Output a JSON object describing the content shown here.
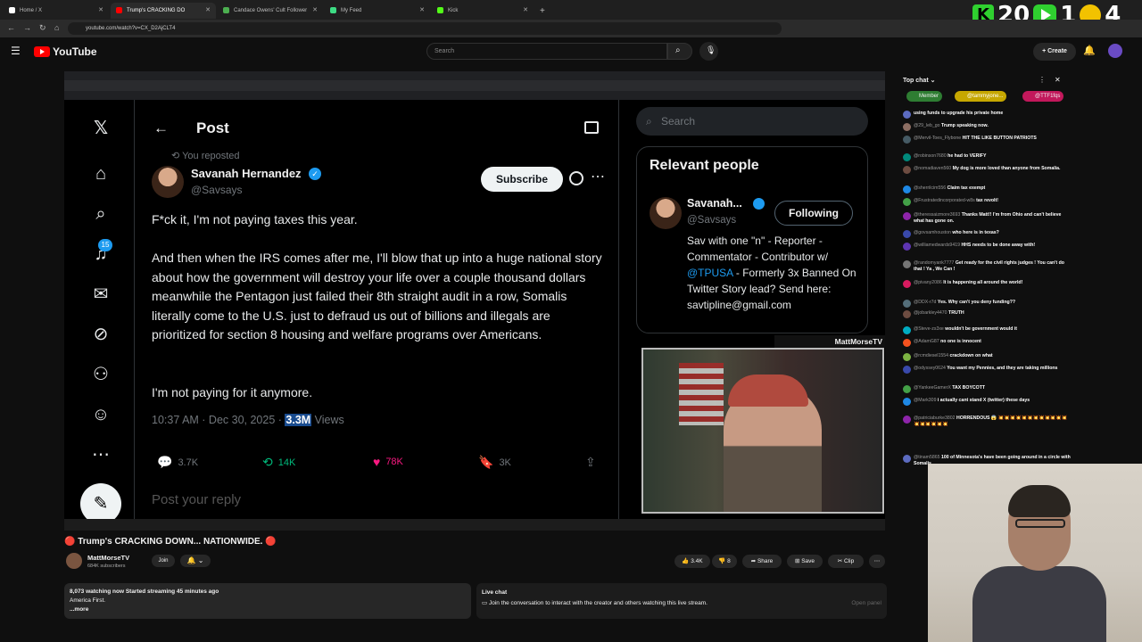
{
  "browser": {
    "tabs": [
      {
        "label": "Home / X",
        "active": false,
        "color": "#ffffff"
      },
      {
        "label": "Trump's CRACKING DO",
        "active": true,
        "color": "#ff0000"
      },
      {
        "label": "Candace Owens' Cult Follower",
        "active": false,
        "color": "#4caf50"
      },
      {
        "label": "My Feed",
        "active": false,
        "color": "#3ddc84"
      },
      {
        "label": "Kick",
        "active": false,
        "color": "#53fc18"
      }
    ],
    "url": "youtube.com/watch?v=CX_D2AjCLT4"
  },
  "overlay": {
    "score_a": "20",
    "score_b": "1",
    "score_c": "4",
    "k_label": "K"
  },
  "youtube": {
    "logo_text": "YouTube",
    "search_placeholder": "Search",
    "create_label": "Create"
  },
  "x_post": {
    "page_title": "Post",
    "reposted_label": "You reposted",
    "author_name": "Savanah Hernandez",
    "author_handle": "@Savsays",
    "subscribe_label": "Subscribe",
    "notif_count": "15",
    "paragraphs": [
      "F*ck it, I'm not paying taxes this year.",
      "And then when the IRS comes after me, I'll blow that up into a huge national story about how the government will destroy your life over a couple thousand dollars meanwhile the Pentagon just failed their 8th straight audit in a row, Somalis literally come to the U.S. just to defraud us out of billions and illegals are prioritized for section 8 housing and welfare programs over Americans.",
      "I'm not paying for it anymore."
    ],
    "timestamp": "10:37 AM · Dec 30, 2025 · ",
    "views_count": "3.3M",
    "views_label": " Views",
    "stats": {
      "replies": "3.7K",
      "reposts": "14K",
      "likes": "78K",
      "bookmarks": "3K"
    },
    "reply_placeholder": "Post your reply"
  },
  "x_sidebar": {
    "search_placeholder": "Search",
    "relevant_title": "Relevant people",
    "person_name": "Savanah...",
    "person_handle": "@Savsays",
    "follow_label": "Following",
    "bio_1": "Sav with one \"n\" - Reporter - Commentator - Contributor w/ ",
    "bio_link": "@TPUSA",
    "bio_2": " - Formerly 3x Banned On Twitter Story lead? Send here: savtiplin​e@gmail.com"
  },
  "cam_label": "MattMorseTV",
  "video": {
    "title": "🔴 Trump's CRACKING DOWN... NATIONWIDE. 🔴",
    "channel": "MattMorseTV",
    "subscribers": "684K subscribers",
    "join_label": "Join",
    "likes": "3.4K",
    "dislikes": "8",
    "share_label": "Share",
    "save_label": "Save",
    "clip_label": "Clip",
    "desc_line1": "8,073 watching now  Started streaming 45 minutes ago",
    "desc_line2": "America First.",
    "desc_more": "...more",
    "livechat_title": "Live chat",
    "livechat_text": "Join the conversation to interact with the creator and others watching this live stream.",
    "open_panel": "Open panel"
  },
  "chat": {
    "header": "Top chat",
    "chip_member": "Member",
    "chip_user": "@tammyjone...",
    "chip_third": "@TTF1fqs",
    "messages": [
      {
        "user": "",
        "text": "using funds to upgrade his private home",
        "color": "#5c6bc0"
      },
      {
        "user": "@29_leb_go",
        "text": "Trump speaking now.",
        "color": "#8d6e63"
      },
      {
        "user": "@Mervil-Toes_Flybone",
        "text": "HIT THE LIKE BUTTON PATRIOTS",
        "color": "#455a64"
      },
      {
        "user": "@robinson7680",
        "text": "he had to VERIFY",
        "color": "#00897b"
      },
      {
        "user": "@nomadiaven560",
        "text": "My dog is more loved than anyone from Somalia.",
        "color": "#6d4c41"
      },
      {
        "user": "@sherrilcim556",
        "text": "Claim tax exempt",
        "color": "#1e88e5"
      },
      {
        "user": "@Frustratedincorporated-w8s",
        "text": "tax revolt!",
        "color": "#43a047"
      },
      {
        "user": "@theressaizmore3693",
        "text": "Thanks Matt!! I'm from Ohio and can't believe what has gone on.",
        "color": "#8e24aa"
      },
      {
        "user": "@govsamhouston",
        "text": "who here is in texas?",
        "color": "#3949ab"
      },
      {
        "user": "@williamedwards9419",
        "text": "HHS needs to be done away with!",
        "color": "#5e35b1"
      },
      {
        "user": "@randomyank7777",
        "text": "Get ready for the civil rights judges ! You can't do that ! Ya , We Can !",
        "color": "#757575"
      },
      {
        "user": "@pivany2086",
        "text": "It is happening all around the world!",
        "color": "#d81b60"
      },
      {
        "user": "@DDX-r7d",
        "text": "Yes. Why can't you deny funding??",
        "color": "#546e7a"
      },
      {
        "user": "@jobarkley4470",
        "text": "TRUTH",
        "color": "#6d4c41"
      },
      {
        "user": "@Steve-zs3xe",
        "text": "wouldn't be government would it",
        "color": "#00acc1"
      },
      {
        "user": "@AdamG87",
        "text": "no one is innocent",
        "color": "#f4511e"
      },
      {
        "user": "@rcmdiesel1554",
        "text": "crackdown on what",
        "color": "#7cb342"
      },
      {
        "user": "@odyssey0624",
        "text": "You want my Pennies, and they are taking millions",
        "color": "#3949ab"
      },
      {
        "user": "@YankeeGamerX",
        "text": "TAX BOYCOTT",
        "color": "#43a047"
      },
      {
        "user": "@Mark309",
        "text": "i actually cant stand X (twitter) these days",
        "color": "#1e88e5"
      },
      {
        "user": "@patriciaburke3802",
        "text": "HORRENDOUS 😱 💥💥💥💥💥💥💥💥💥💥💥💥💥💥💥💥💥💥",
        "color": "#8e24aa"
      },
      {
        "user": "@tinam5865",
        "text": "100 of Minnesota's have been going around in a circle with Somalis",
        "color": "#5c6bc0"
      }
    ]
  }
}
